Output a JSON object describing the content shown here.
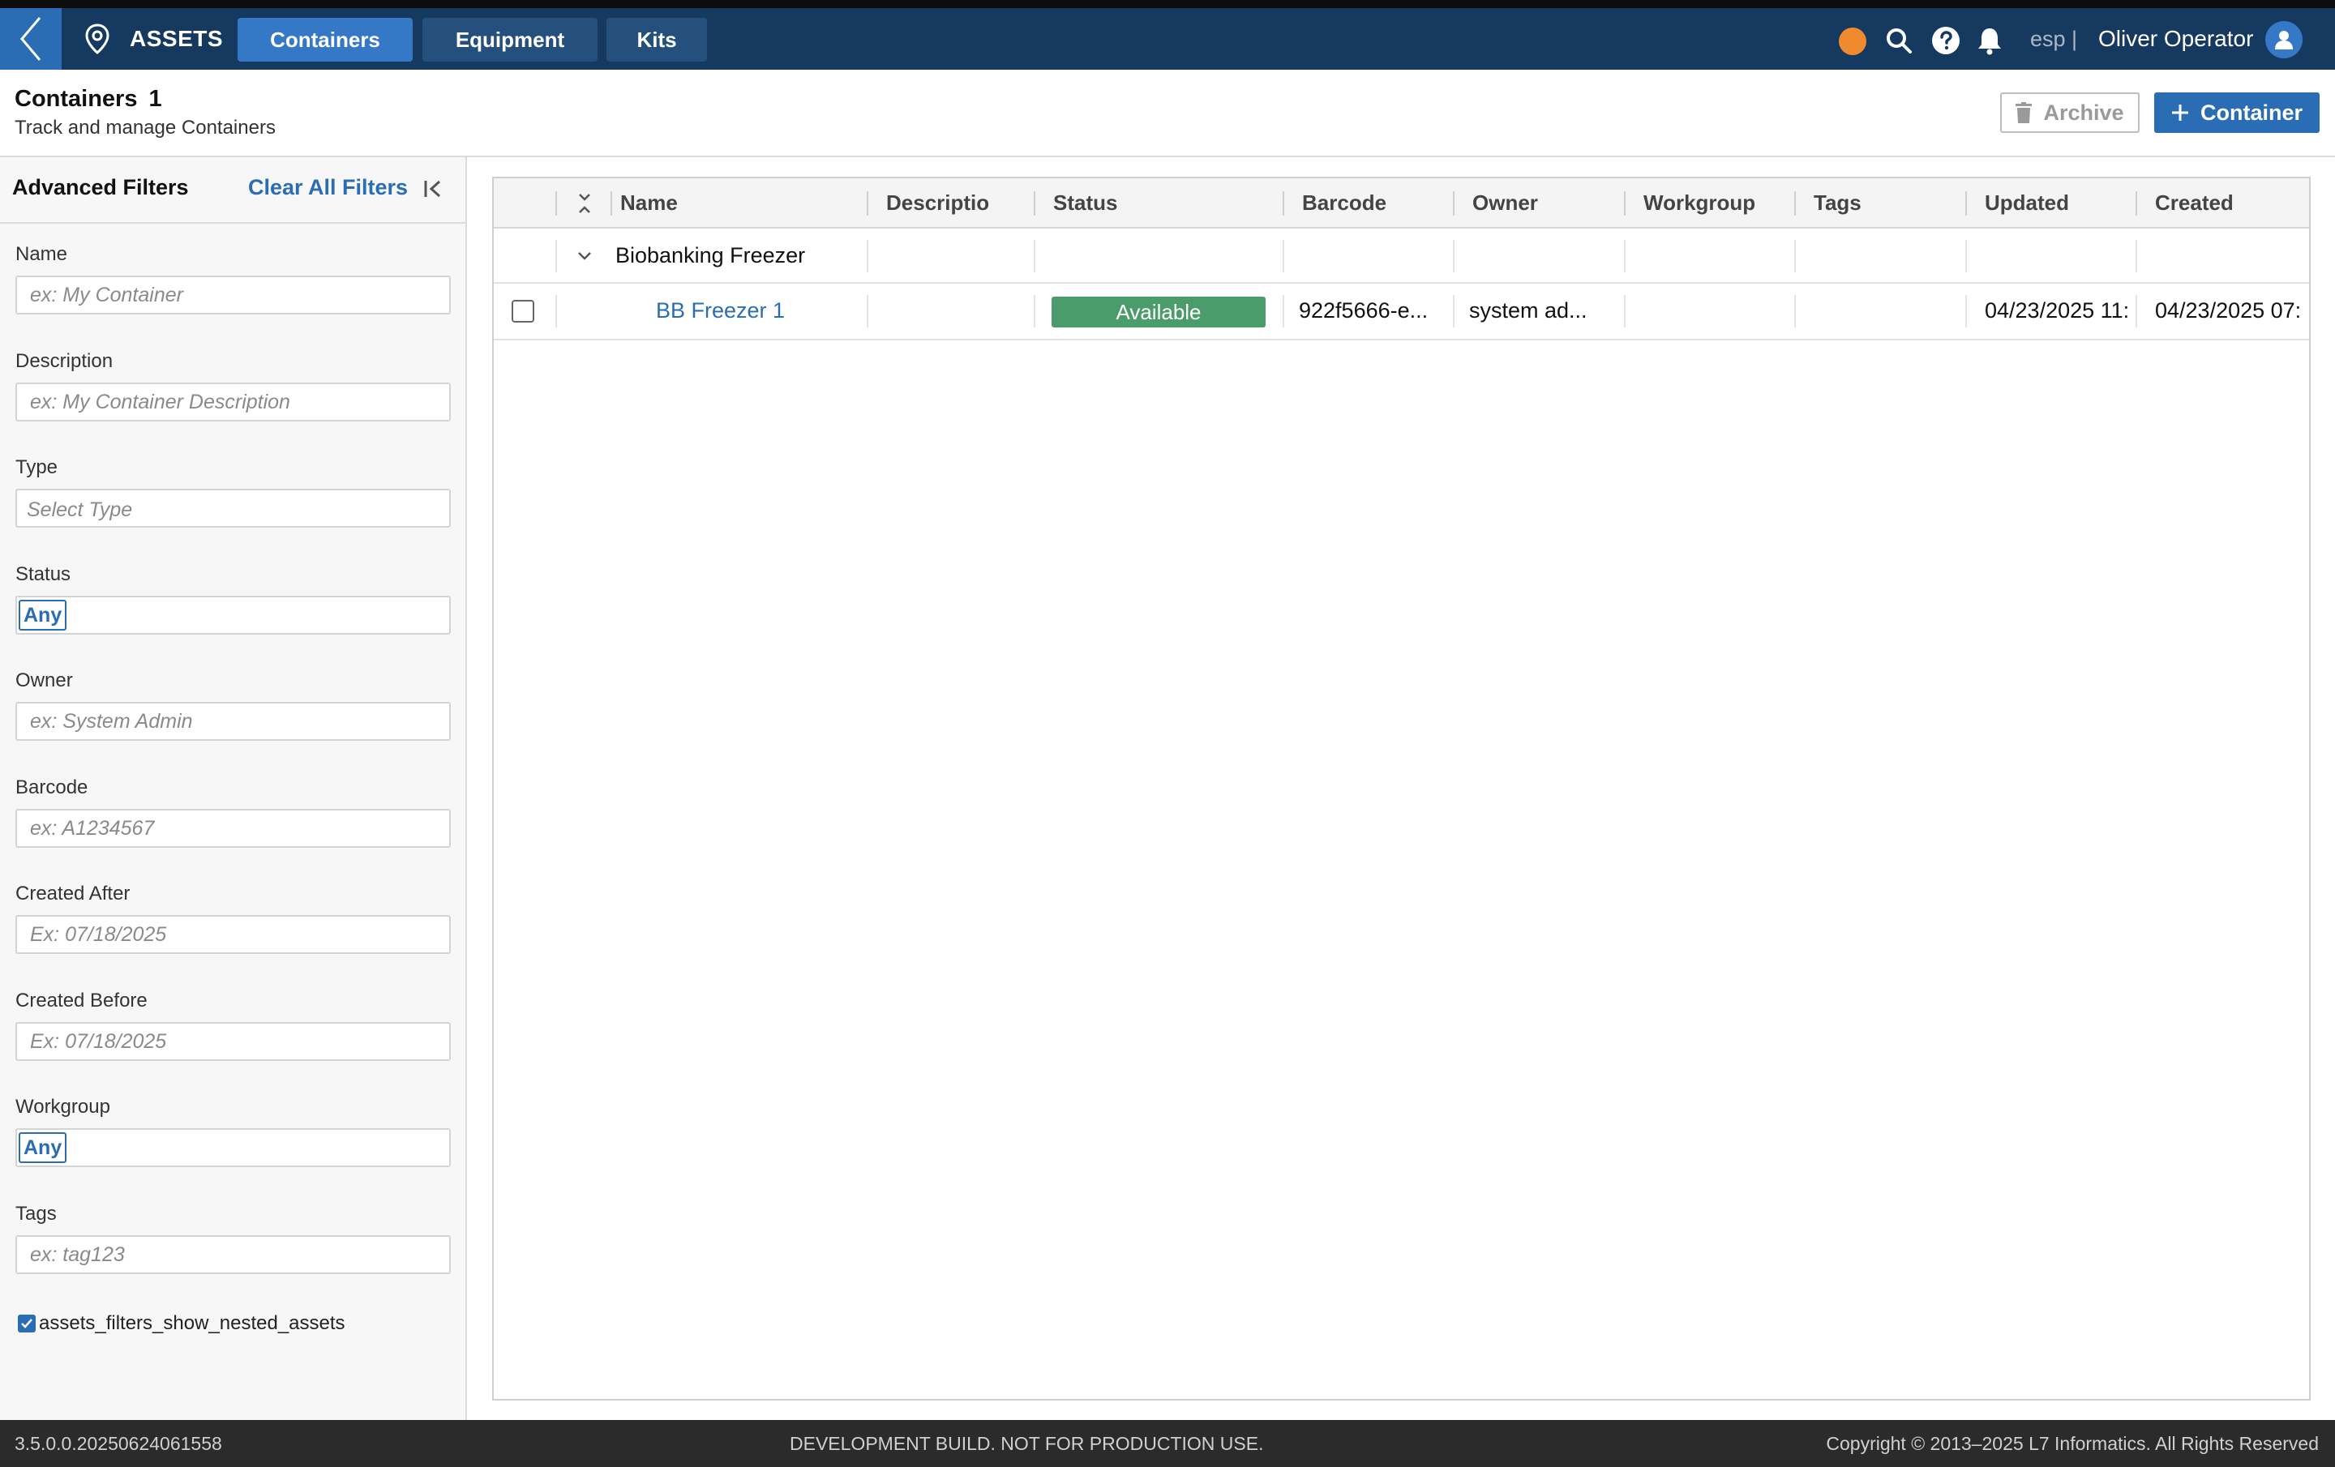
{
  "nav": {
    "app_title": "ASSETS",
    "tabs": [
      {
        "label": "Containers",
        "active": true
      },
      {
        "label": "Equipment",
        "active": false
      },
      {
        "label": "Kits",
        "active": false
      }
    ],
    "lang": "esp |",
    "user_name": "Oliver Operator",
    "status_dot_color": "#f08a2e",
    "icons": [
      "chevron-left-icon",
      "location-pin-icon",
      "search-icon",
      "help-icon",
      "bell-icon",
      "user-avatar-icon"
    ]
  },
  "header": {
    "title": "Containers",
    "count": "1",
    "subtitle": "Track and manage Containers",
    "archive_label": "Archive",
    "add_label": "Container"
  },
  "filters": {
    "title": "Advanced Filters",
    "clear_label": "Clear All Filters",
    "name": {
      "label": "Name",
      "placeholder": "ex: My Container"
    },
    "description": {
      "label": "Description",
      "placeholder": "ex: My Container Description"
    },
    "type": {
      "label": "Type",
      "placeholder": "Select Type"
    },
    "status": {
      "label": "Status",
      "value": "Any"
    },
    "owner": {
      "label": "Owner",
      "placeholder": "ex: System Admin"
    },
    "barcode": {
      "label": "Barcode",
      "placeholder": "ex: A1234567"
    },
    "created_after": {
      "label": "Created After",
      "placeholder": "Ex: 07/18/2025"
    },
    "created_before": {
      "label": "Created Before",
      "placeholder": "Ex: 07/18/2025"
    },
    "workgroup": {
      "label": "Workgroup",
      "value": "Any"
    },
    "tags": {
      "label": "Tags",
      "placeholder": "ex: tag123"
    },
    "show_nested": {
      "label": "assets_filters_show_nested_assets",
      "checked": true
    }
  },
  "table": {
    "columns": [
      "Name",
      "Descriptio",
      "Status",
      "Barcode",
      "Owner",
      "Workgroup",
      "Tags",
      "Updated",
      "Created"
    ],
    "group": {
      "label": "Biobanking Freezer",
      "expanded": true
    },
    "rows": [
      {
        "name": "BB Freezer 1",
        "description": "",
        "status": "Available",
        "barcode": "922f5666-e...",
        "owner": "system ad...",
        "workgroup": "",
        "tags": "",
        "updated": "04/23/2025 11:",
        "created": "04/23/2025 07:"
      }
    ]
  },
  "footer": {
    "version": "3.5.0.0.20250624061558",
    "notice": "DEVELOPMENT BUILD. NOT FOR PRODUCTION USE.",
    "copyright": "Copyright © 2013–2025 L7 Informatics. All Rights Reserved"
  },
  "colors": {
    "nav_bg": "#163a5f",
    "accent": "#2a6db5",
    "status_available": "#4b9c6b",
    "footer_bg": "#2b2b2b"
  }
}
